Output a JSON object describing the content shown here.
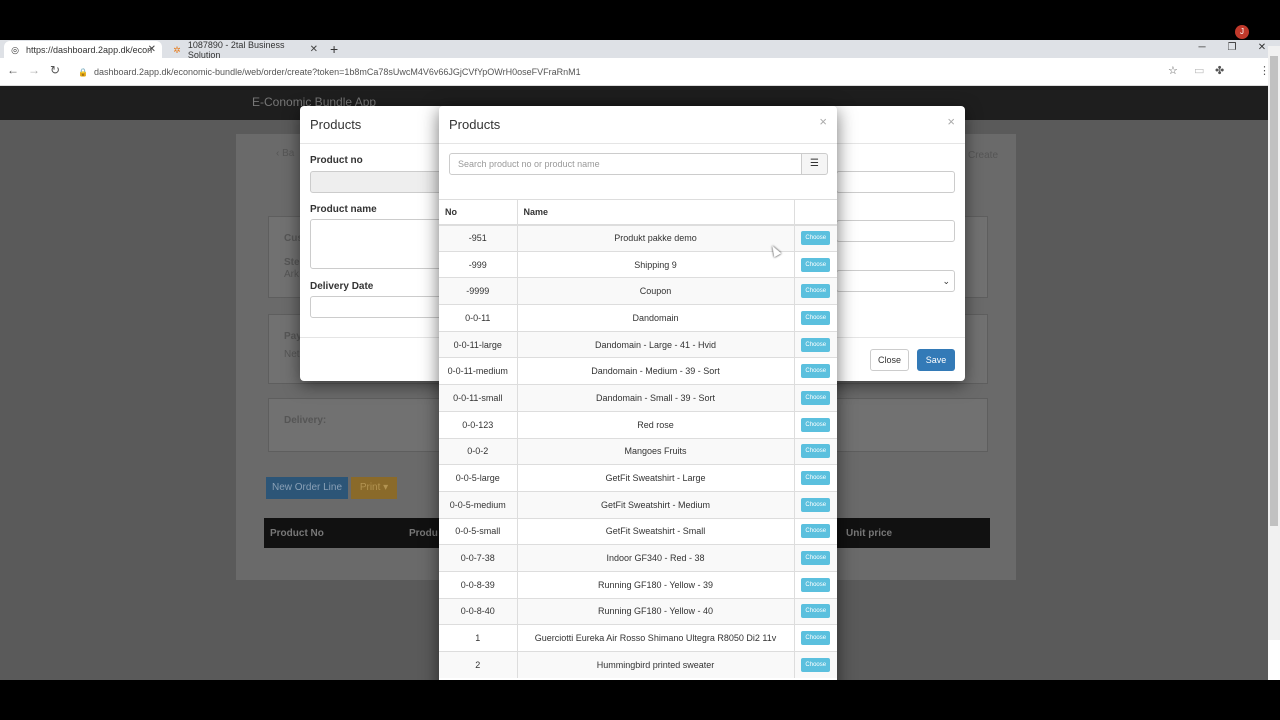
{
  "browser": {
    "tabs": [
      {
        "title": "https://dashboard.2app.dk/econ",
        "icon": "globe-icon"
      },
      {
        "title": "1087890 - 2tal Business Solution",
        "icon": "app-icon"
      }
    ],
    "new_tab": "+",
    "url": "dashboard.2app.dk/economic-bundle/web/order/create?token=1b8mCa78sUwcM4V6v66JGjCVfYpOWrH0oseFVFraRnM1",
    "profile_initial": "J"
  },
  "app": {
    "title": "E-Conomic Bundle App",
    "back_label": "Ba",
    "create_label": "Create",
    "bg_labels": {
      "customer": "Cus",
      "street": "Ste",
      "arkiv": "Ark",
      "pay": "Pay",
      "net": "Net",
      "delivery": "Delivery:"
    },
    "new_order_line": "New Order Line",
    "print": "Print",
    "order_columns": [
      "Product No",
      "Produ",
      "Unit price"
    ]
  },
  "product_modal": {
    "title": "Products",
    "close_x": "×",
    "product_no_label": "Product no",
    "product_name_label": "Product name",
    "delivery_date_label": "Delivery Date",
    "close_button": "Close",
    "save_button": "Save"
  },
  "picker_modal": {
    "title": "Products",
    "close_x": "×",
    "search_placeholder": "Search product no or product name",
    "columns": {
      "no": "No",
      "name": "Name"
    },
    "choose_label": "Choose",
    "rows": [
      {
        "no": "-951",
        "name": "Produkt pakke demo"
      },
      {
        "no": "-999",
        "name": "Shipping 9"
      },
      {
        "no": "-9999",
        "name": "Coupon"
      },
      {
        "no": "0-0-11",
        "name": "Dandomain"
      },
      {
        "no": "0-0-11-large",
        "name": "Dandomain - Large - 41 - Hvid"
      },
      {
        "no": "0-0-11-medium",
        "name": "Dandomain - Medium - 39 - Sort"
      },
      {
        "no": "0-0-11-small",
        "name": "Dandomain - Small - 39 - Sort"
      },
      {
        "no": "0-0-123",
        "name": "Red rose"
      },
      {
        "no": "0-0-2",
        "name": "Mangoes Fruits"
      },
      {
        "no": "0-0-5-large",
        "name": "GetFit Sweatshirt - Large"
      },
      {
        "no": "0-0-5-medium",
        "name": "GetFit Sweatshirt - Medium"
      },
      {
        "no": "0-0-5-small",
        "name": "GetFit Sweatshirt - Small"
      },
      {
        "no": "0-0-7-38",
        "name": "Indoor GF340 - Red - 38"
      },
      {
        "no": "0-0-8-39",
        "name": "Running GF180 - Yellow - 39"
      },
      {
        "no": "0-0-8-40",
        "name": "Running GF180 - Yellow - 40"
      },
      {
        "no": "1",
        "name": "Guerciotti Eureka Air Rosso Shimano Ultegra R8050 Di2 11v"
      },
      {
        "no": "2",
        "name": "Hummingbird printed sweater"
      }
    ]
  },
  "colors": {
    "primary": "#337ab7",
    "info": "#5bc0de",
    "overlay": "#5a5a5a"
  }
}
